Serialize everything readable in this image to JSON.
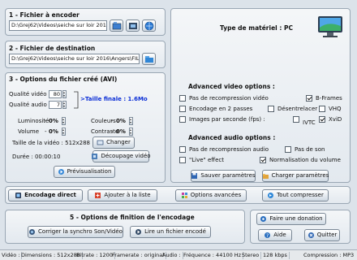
{
  "section1": {
    "title": "1 - Fichier à encoder",
    "path": "D:\\Grej62\\Videos\\seiche sur loir 2016\\Anger"
  },
  "section2": {
    "title": "2 - Fichier de destination",
    "path": "D:\\Grej62\\Videos\\seiche sur loir 2016\\Angers\\FILE0009_PC"
  },
  "section3": {
    "title": "3 - Options du fichier créé (AVI)",
    "qualite_video_label": "Qualité vidéo :",
    "qualite_video_value": "80",
    "qualite_audio_label": "Qualité audio :",
    "qualite_audio_value": "7",
    "taille_finale": ">Taille finale : 1.6Mo",
    "luminosite_label": "Luminosité",
    "luminosite_value": "0%",
    "couleurs_label": "Couleurs",
    "couleurs_value": "0%",
    "volume_label": "Volume",
    "volume_value": "0%",
    "contraste_label": "Contraste",
    "contraste_value": "0%",
    "taille_video": "Taille de la vidéo : 512x288",
    "changer_btn": "Changer",
    "duree": "Durée : 00:00:10",
    "decoupage_btn": "Découpage vidéo",
    "previsualisation_btn": "Prévisualisation"
  },
  "materiel": "Type de matériel : PC",
  "advanced_video": {
    "title": "Advanced video options :",
    "options": [
      {
        "label": "Pas de recompression vidéo",
        "checked": false
      },
      {
        "label": "B-Frames",
        "checked": true
      },
      {
        "label": "Encodage en 2 passes",
        "checked": false
      },
      {
        "label": "Désentrelacer",
        "checked": false
      },
      {
        "label": "VHQ",
        "checked": false
      },
      {
        "label": "Images par seconde (fps) :",
        "checked": false
      },
      {
        "label": "IVTC",
        "checked": false
      },
      {
        "label": "XviD",
        "checked": true
      }
    ]
  },
  "advanced_audio": {
    "title": "Advanced audio options :",
    "options": [
      {
        "label": "Pas de recompression audio",
        "checked": false
      },
      {
        "label": "Pas de son",
        "checked": false
      },
      {
        "label": "\"Live\" effect",
        "checked": false
      },
      {
        "label": "Normalisation du volume",
        "checked": true
      }
    ]
  },
  "buttons": {
    "sauver": "Sauver paramètres",
    "charger": "Charger paramètres",
    "encodage_direct": "Encodage direct",
    "ajouter": "Ajouter à la liste",
    "options_avancees": "Options avancées",
    "tout_compresser": "Tout compresser"
  },
  "section5": {
    "title": "5 - Options de finition de l'encodage",
    "corriger": "Corriger la synchro Son/Vidéo",
    "lire": "Lire un fichier encodé"
  },
  "side": {
    "donation": "Faire une donation",
    "aide": "Aide",
    "quitter": "Quitter"
  },
  "status": [
    "Vidéo :",
    "Dimensions : 512x288",
    "Bitrate : 1200",
    "Framerate : original",
    "Audio :",
    "Fréquence : 44100 Hz",
    "Stereo",
    "128 kbps",
    "Compression : MP3"
  ],
  "colors": {
    "accent_blue": "#0b2fd6",
    "panel_border": "#9aa7b4"
  }
}
